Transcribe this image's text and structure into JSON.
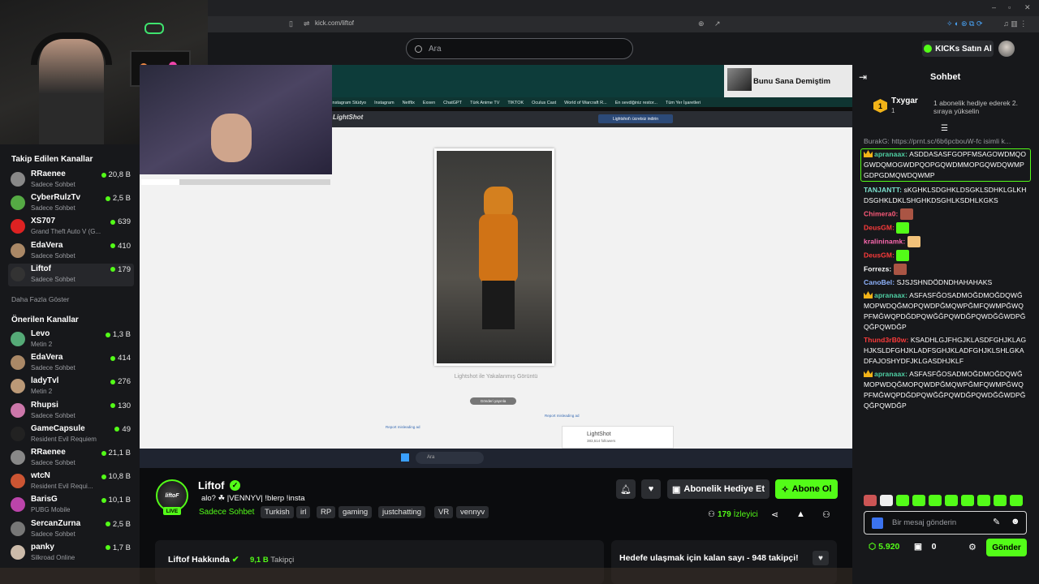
{
  "browser": {
    "url": "kick.com/liftof"
  },
  "header": {
    "search_placeholder": "Ara",
    "kicks_label": "KICKs Satın Al"
  },
  "sidebar": {
    "followed_title": "Takip Edilen Kanallar",
    "followed": [
      {
        "name": "RRaenee",
        "sub": "Sadece Sohbet",
        "viewers": "20,8 B",
        "color": "#888"
      },
      {
        "name": "CyberRulzTv",
        "sub": "Sadece Sohbet",
        "viewers": "2,5 B",
        "color": "#5a4"
      },
      {
        "name": "XS707",
        "sub": "Grand Theft Auto V (G...",
        "viewers": "639",
        "color": "#d22"
      },
      {
        "name": "EdaVera",
        "sub": "Sadece Sohbet",
        "viewers": "410",
        "color": "#a86"
      },
      {
        "name": "Liftof",
        "sub": "Sadece Sohbet",
        "viewers": "179",
        "color": "#333"
      }
    ],
    "show_more": "Daha Fazla Göster",
    "recommended_title": "Önerilen Kanallar",
    "recommended": [
      {
        "name": "Levo",
        "sub": "Metin 2",
        "viewers": "1,3 B",
        "color": "#5a7"
      },
      {
        "name": "EdaVera",
        "sub": "Sadece Sohbet",
        "viewers": "414",
        "color": "#a86"
      },
      {
        "name": "ladyTvl",
        "sub": "Metin 2",
        "viewers": "276",
        "color": "#b97"
      },
      {
        "name": "Rhupsi",
        "sub": "Sadece Sohbet",
        "viewers": "130",
        "color": "#c7a"
      },
      {
        "name": "GameCapsule",
        "sub": "Resident Evil Requiem",
        "viewers": "49",
        "color": "#222"
      },
      {
        "name": "RRaenee",
        "sub": "Sadece Sohbet",
        "viewers": "21,1 B",
        "color": "#888"
      },
      {
        "name": "wtcN",
        "sub": "Resident Evil Requi...",
        "viewers": "10,8 B",
        "color": "#c53"
      },
      {
        "name": "BarisG",
        "sub": "PUBG Mobile",
        "viewers": "10,1 B",
        "color": "#b4a"
      },
      {
        "name": "SercanZurna",
        "sub": "Sadece Sohbet",
        "viewers": "2,5 B",
        "color": "#777"
      },
      {
        "name": "panky",
        "sub": "Silkroad Online",
        "viewers": "1,7 B",
        "color": "#cba"
      }
    ]
  },
  "video": {
    "pip_title": "Bunu Sana Demiştim",
    "bookmarks": [
      "Instagram Stüdyo",
      "Instagram",
      "Netflix",
      "Exxen",
      "ChatGPT",
      "Türk Anime TV",
      "TIKTOK",
      "Oculus Cast",
      "World of Warcraft R...",
      "En sevdiğiniz restor...",
      "Tüm Yer İşaretleri"
    ],
    "lightshot_brand": "LightShot",
    "lightshot_button": "Lightshot'ı ücretsiz indirin",
    "caption": "Lightshot ile Yakalanmış Görüntü",
    "send_label": "Gönderi yayınla",
    "report_left": "Report misleading ad",
    "report_right": "Report misleading ad",
    "ad_title": "LightShot",
    "ad_sub": "383,514 followers",
    "taskbar_search": "Ara"
  },
  "stream": {
    "name": "Liftof",
    "live": "LIVE",
    "avatar_text": "liftoF",
    "title": "alo? ☘ |VENNYV| !blerp !insta",
    "category": "Sadece Sohbet",
    "tags": [
      "Turkish",
      "irl",
      "RP",
      "gaming",
      "justchatting",
      "VR",
      "vennyv"
    ],
    "gift_label": "Abonelik Hediye Et",
    "subscribe_label": "Abone Ol",
    "viewers": "179",
    "viewers_label": "İzleyici",
    "about_title": "Liftof Hakkında",
    "followers": "9,1 B",
    "followers_label": "Takipçi",
    "goal_text": "Hedefe ulaşmak için kalan sayı - 948 takipçi!"
  },
  "chat": {
    "title": "Sohbet",
    "pinned_user": "Txygar",
    "pinned_rank": "1",
    "pinned_count": "1",
    "pinned_text": "1 abonelik hediye ederek 2. sıraya yükselin",
    "reply_preview": "BurakG: https://prnt.sc/6b6pcbouW-fc isimli k...",
    "messages": [
      {
        "user": "apranaax",
        "color": "#4fd1a5",
        "text": "ASDDASASFGOPFMSAGOWDMQOGWDQMOGWDPQOPGQWDMMOPGQWDQWMPGDPGDMQWDQWMP",
        "crown": true,
        "highlight": true
      },
      {
        "user": "TANJANTT",
        "color": "#7de3d0",
        "text": "sKGHKLSDGHKLDSGKLSDHKLGLKHDSGHKLDKLSHGHKDSGHLKSDHLKGKS"
      },
      {
        "user": "Chimera0",
        "color": "#ff5a7a",
        "text": "",
        "emote": "#a54"
      },
      {
        "user": "DeusGM",
        "color": "#ff3b3b",
        "text": "",
        "emote": "#53fc18"
      },
      {
        "user": "kralininamk",
        "color": "#ff6ab2",
        "text": "",
        "emote": "#f2c27a"
      },
      {
        "user": "DeusGM",
        "color": "#ff3b3b",
        "text": "",
        "emote": "#53fc18"
      },
      {
        "user": "Forrezs",
        "color": "#ffffff",
        "text": "",
        "emote": "#a54"
      },
      {
        "user": "CanoBel",
        "color": "#8fb4ff",
        "text": "SJSJSHNDÖDNDHAHAHAKS"
      },
      {
        "user": "apranaax",
        "color": "#4fd1a5",
        "text": "ASFASFĞOSADMOĞDMOĞDQWĞMOPWDQĞMOPQWDPĞMQWPĞMFQWMPĞWQPFMĞWQPDĞDPQWĞĞPQWDĞPQWDĞĞWDPĞQĞPQWDĞP",
        "crown": true
      },
      {
        "user": "Thund3rB0w",
        "color": "#ff3b3b",
        "text": "KSADHLGJFHGJKLASDFGHJKLAGHJKSLDFGHJKLADFSGHJKLADFGHJKLSHLGKADFAJOSHYDFJKLGASDHJKLF"
      },
      {
        "user": "apranaax",
        "color": "#4fd1a5",
        "text": "ASFASFĞOSADMOĞDMOĞDQWĞMOPWDQĞMOPQWDPĞMQWPĞMFQWMPĞWQPFMĞWQPDĞDPQWĞĞPQWDĞPQWDĞĞWDPĞQĞPQWDĞP",
        "crown": true
      }
    ],
    "input_placeholder": "Bir mesaj gönderin",
    "points": "5.920",
    "zero": "0",
    "send_label": "Gönder"
  }
}
